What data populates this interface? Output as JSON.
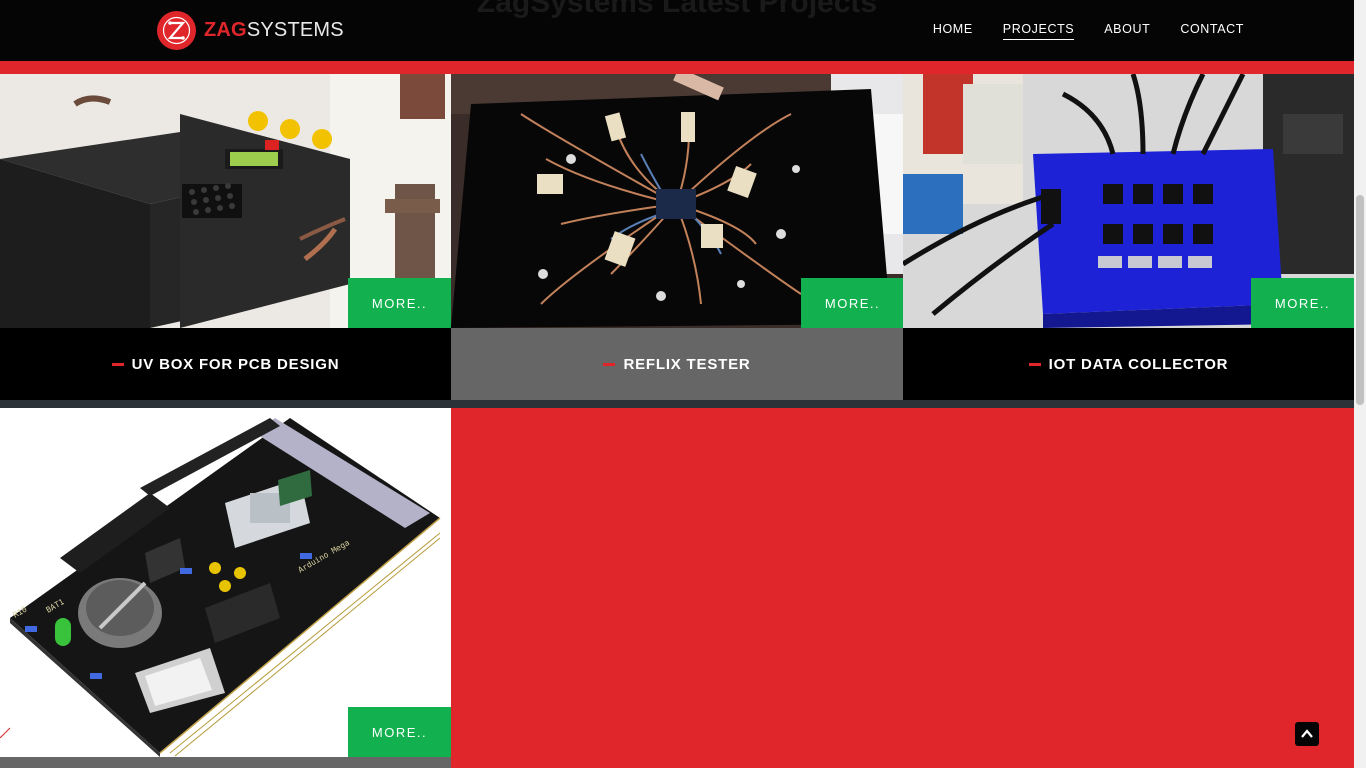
{
  "header": {
    "logo_zag": "ZAG",
    "logo_systems": "SYSTEMS",
    "ghost_title": "ZagSystems Latest Projects",
    "nav": [
      {
        "label": "HOME",
        "active": false
      },
      {
        "label": "PROJECTS",
        "active": true
      },
      {
        "label": "ABOUT",
        "active": false
      },
      {
        "label": "CONTACT",
        "active": false
      }
    ]
  },
  "projects": [
    {
      "title": "UV BOX FOR PCB DESIGN",
      "more_label": "MORE..",
      "image": "uv-box-photo",
      "caption_bg": "#000000"
    },
    {
      "title": "REFLIX TESTER",
      "more_label": "MORE..",
      "image": "reflix-tester-photo",
      "caption_bg": "#666666"
    },
    {
      "title": "IOT DATA COLLECTOR",
      "more_label": "MORE..",
      "image": "iot-data-collector-photo",
      "caption_bg": "#000000"
    },
    {
      "title": "",
      "more_label": "MORE..",
      "image": "arduino-shield-render",
      "caption_bg": "#666666"
    }
  ],
  "colors": {
    "brand_red": "#e0262b",
    "button_green": "#12b04f",
    "header_black": "#050505",
    "divider": "#2b3338"
  },
  "icons": {
    "scroll_top": "chevron-up-icon",
    "logo": "zag-logo-icon"
  }
}
